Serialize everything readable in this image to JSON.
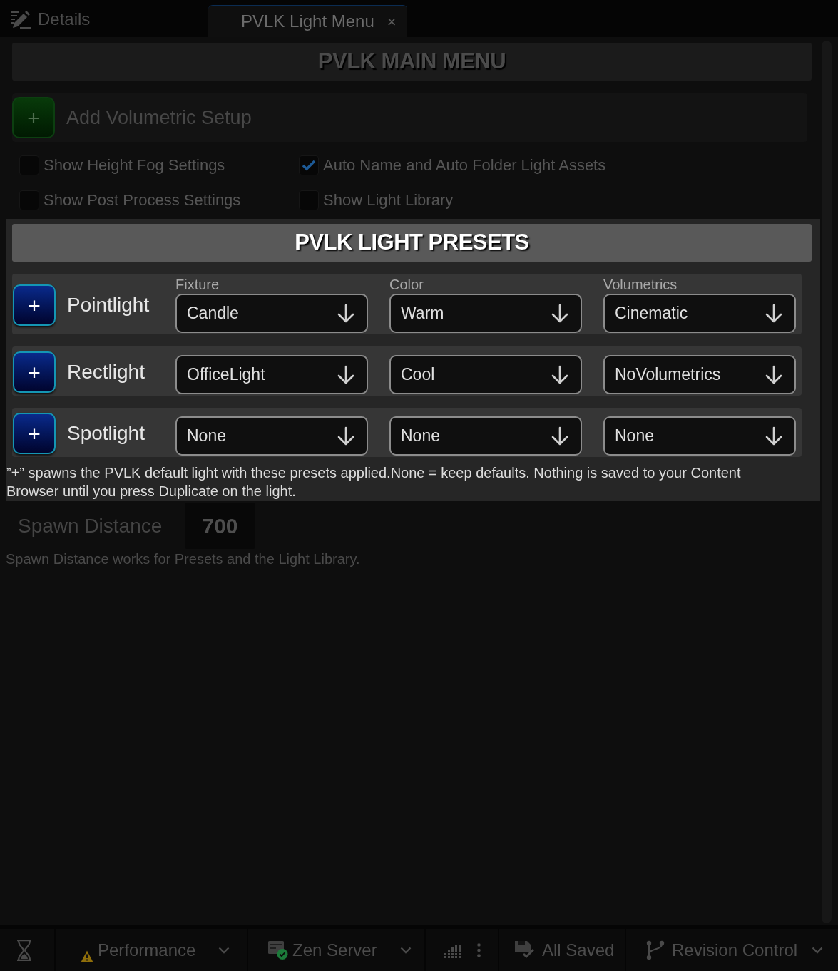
{
  "tabs": [
    {
      "kind": "details-panel",
      "label": "Details",
      "selected": false
    },
    {
      "kind": "widget",
      "label": "PVLK Light Menu",
      "selected": true,
      "close": "×"
    }
  ],
  "main_menu": {
    "title": "PVLK MAIN MENU",
    "disabled": true,
    "add_button": {
      "label": "+",
      "text": "Add Volumetric Setup"
    },
    "checkboxes": [
      {
        "label": "Show Height Fog Settings",
        "checked": false
      },
      {
        "label": "Auto Name and Auto Folder Light Assets",
        "checked": true
      },
      {
        "label": "Show Post Process Settings",
        "checked": false
      },
      {
        "label": "Show Light Library",
        "checked": false
      }
    ]
  },
  "presets": {
    "title": "PVLK LIGHT PRESETS",
    "columns": [
      "Fixture",
      "Color",
      "Volumetrics"
    ],
    "rows": [
      {
        "button": "+",
        "label": "Pointlight",
        "values": [
          "Candle",
          "Warm",
          "Cinematic"
        ]
      },
      {
        "button": "+",
        "label": "Rectlight",
        "values": [
          "OfficeLight",
          "Cool",
          "NoVolumetrics"
        ]
      },
      {
        "button": "+",
        "label": "Spotlight",
        "values": [
          "None",
          "None",
          "None"
        ]
      }
    ],
    "note": "”+” spawns the PVLK default light with these presets applied.None = keep defaults. Nothing is saved to your Content Browser until you press Duplicate on the light."
  },
  "spawn": {
    "label": "Spawn Distance",
    "value": "700",
    "disabled": true,
    "note": "Spawn Distance works for Presets and the Light Library."
  },
  "status_bar": [
    {
      "kind": "hourglass"
    },
    {
      "kind": "performance",
      "label": "Performance",
      "dropdown": true
    },
    {
      "kind": "zen-server",
      "label": "Zen Server",
      "dropdown": true
    },
    {
      "kind": "grid-menu"
    },
    {
      "kind": "save",
      "label": "All Saved",
      "dropdown": false
    },
    {
      "kind": "revision-control",
      "label": "Revision Control",
      "dropdown": true
    }
  ]
}
